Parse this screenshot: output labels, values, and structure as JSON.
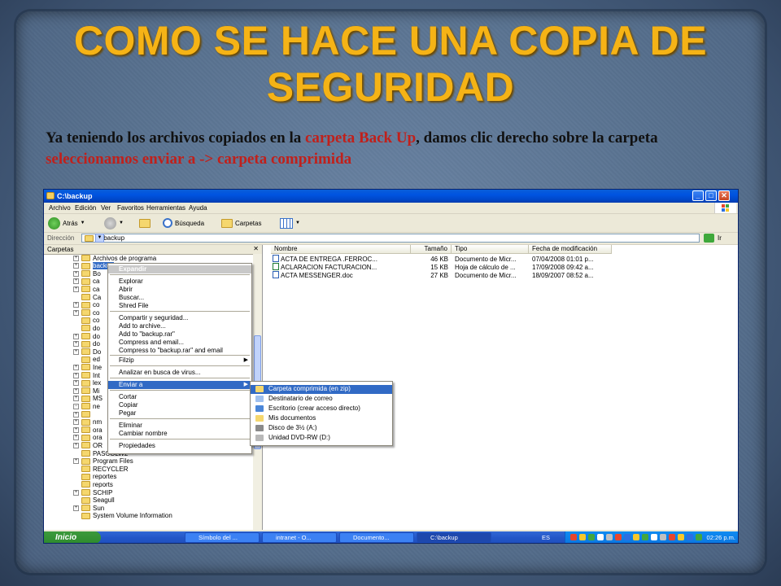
{
  "slide": {
    "title": "COMO SE HACE UNA COPIA DE SEGURIDAD",
    "text": {
      "part1": "Ya teniendo los archivos copiados en la ",
      "part2": "carpeta Back Up",
      "part3": ", damos clic derecho sobre la carpeta ",
      "part4": "seleccionamos enviar a -> carpeta comprimida"
    }
  },
  "window": {
    "title": "C:\\backup",
    "menu": [
      "Archivo",
      "Edición",
      "Ver",
      "Favoritos",
      "Herramientas",
      "Ayuda"
    ],
    "toolbar": {
      "back": "Atrás",
      "search": "Búsqueda",
      "folders": "Carpetas"
    },
    "address": {
      "label": "Dirección",
      "value": "C:\\backup",
      "go": "Ir"
    },
    "left_pane": {
      "header": "Carpetas",
      "close": "✕",
      "tree": [
        {
          "label": "Archivos de programa",
          "expand": "+"
        },
        {
          "label": "backup",
          "expand": "+"
        },
        {
          "label": "Bo",
          "expand": "+"
        },
        {
          "label": "ca",
          "expand": "+"
        },
        {
          "label": "ca",
          "expand": "+"
        },
        {
          "label": "Ca",
          "expand": ""
        },
        {
          "label": "co",
          "expand": "+"
        },
        {
          "label": "co",
          "expand": "+"
        },
        {
          "label": "co",
          "expand": ""
        },
        {
          "label": "do",
          "expand": ""
        },
        {
          "label": "do",
          "expand": "+"
        },
        {
          "label": "do",
          "expand": "+"
        },
        {
          "label": "Do",
          "expand": "+"
        },
        {
          "label": "ed",
          "expand": ""
        },
        {
          "label": "Ine",
          "expand": "+"
        },
        {
          "label": "Int",
          "expand": "+"
        },
        {
          "label": "lex",
          "expand": "+"
        },
        {
          "label": "Mi",
          "expand": "+"
        },
        {
          "label": "MS",
          "expand": "+"
        },
        {
          "label": "ne",
          "expand": "−"
        },
        {
          "label": "",
          "expand": "+"
        },
        {
          "label": "nm",
          "expand": "+"
        },
        {
          "label": "ora",
          "expand": "+"
        },
        {
          "label": "ora",
          "expand": "+"
        },
        {
          "label": "OR",
          "expand": "+"
        },
        {
          "label": "PASCOLW2",
          "expand": ""
        },
        {
          "label": "Program Files",
          "expand": "+"
        },
        {
          "label": "RECYCLER",
          "expand": ""
        },
        {
          "label": "reportes",
          "expand": ""
        },
        {
          "label": "reports",
          "expand": ""
        },
        {
          "label": "SCHIP",
          "expand": "+"
        },
        {
          "label": "Seagull",
          "expand": ""
        },
        {
          "label": "Sun",
          "expand": "+"
        },
        {
          "label": "System Volume Information",
          "expand": ""
        }
      ]
    },
    "right_pane": {
      "columns": [
        "Nombre",
        "Tamaño",
        "Tipo",
        "Fecha de modificación"
      ],
      "files": [
        {
          "name": "ACTA DE ENTREGA .FERROC...",
          "size": "46 KB",
          "type": "Documento de Micr...",
          "date": "07/04/2008 01:01 p..."
        },
        {
          "name": "ACLARACION FACTURACION...",
          "size": "15 KB",
          "type": "Hoja de cálculo de ...",
          "date": "17/09/2008 09:42 a..."
        },
        {
          "name": "ACTA MESSENGER.doc",
          "size": "27 KB",
          "type": "Documento de Micr...",
          "date": "18/09/2007 08:52 a..."
        }
      ]
    },
    "context_menu": {
      "items": [
        "Expandir",
        "Explorar",
        "Abrir",
        "Buscar...",
        "Shred File",
        "Compartir y seguridad...",
        "Add to archive...",
        "Add to \"backup.rar\"",
        "Compress and email...",
        "Compress to \"backup.rar\" and email",
        "Filzip",
        "Analizar en busca de virus...",
        "Enviar a",
        "Cortar",
        "Copiar",
        "Pegar",
        "Eliminar",
        "Cambiar nombre",
        "Propiedades"
      ]
    },
    "sendto_menu": {
      "items": [
        "Carpeta comprimida (en zip)",
        "Destinatario de correo",
        "Escritorio (crear acceso directo)",
        "Mis documentos",
        "Disco de 3½ (A:)",
        "Unidad DVD-RW (D:)"
      ]
    },
    "taskbar": {
      "start": "Inicio",
      "tasks": [
        "Símbolo del ...",
        "intranet - O...",
        "Documento...",
        "C:\\backup"
      ],
      "lang": "ES",
      "clock": "02:26 p.m."
    }
  },
  "colors": {
    "title": "#f5b316",
    "highlight_red": "#c0201b",
    "xp_blue": "#0053e1",
    "select": "#316ac5"
  }
}
